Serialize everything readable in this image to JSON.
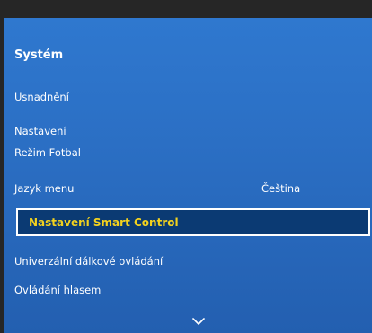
{
  "menu": {
    "title": "Systém",
    "items": [
      {
        "label": "Usnadnění"
      },
      {
        "label": "Nastavení"
      },
      {
        "label": "Režim Fotbal"
      },
      {
        "label": "Jazyk menu",
        "value": "Čeština"
      },
      {
        "label": "Nastavení Smart Control",
        "selected": true
      },
      {
        "label": "Univerzální dálkové ovládání"
      },
      {
        "label": "Ovládání hlasem"
      }
    ],
    "more_icon": "chevron-down-icon"
  },
  "colors": {
    "panel": "#2b6fc4",
    "selected_bg": "#0b3a73",
    "selected_text": "#f3d21e",
    "border": "#ffffff",
    "frame": "#262626"
  }
}
